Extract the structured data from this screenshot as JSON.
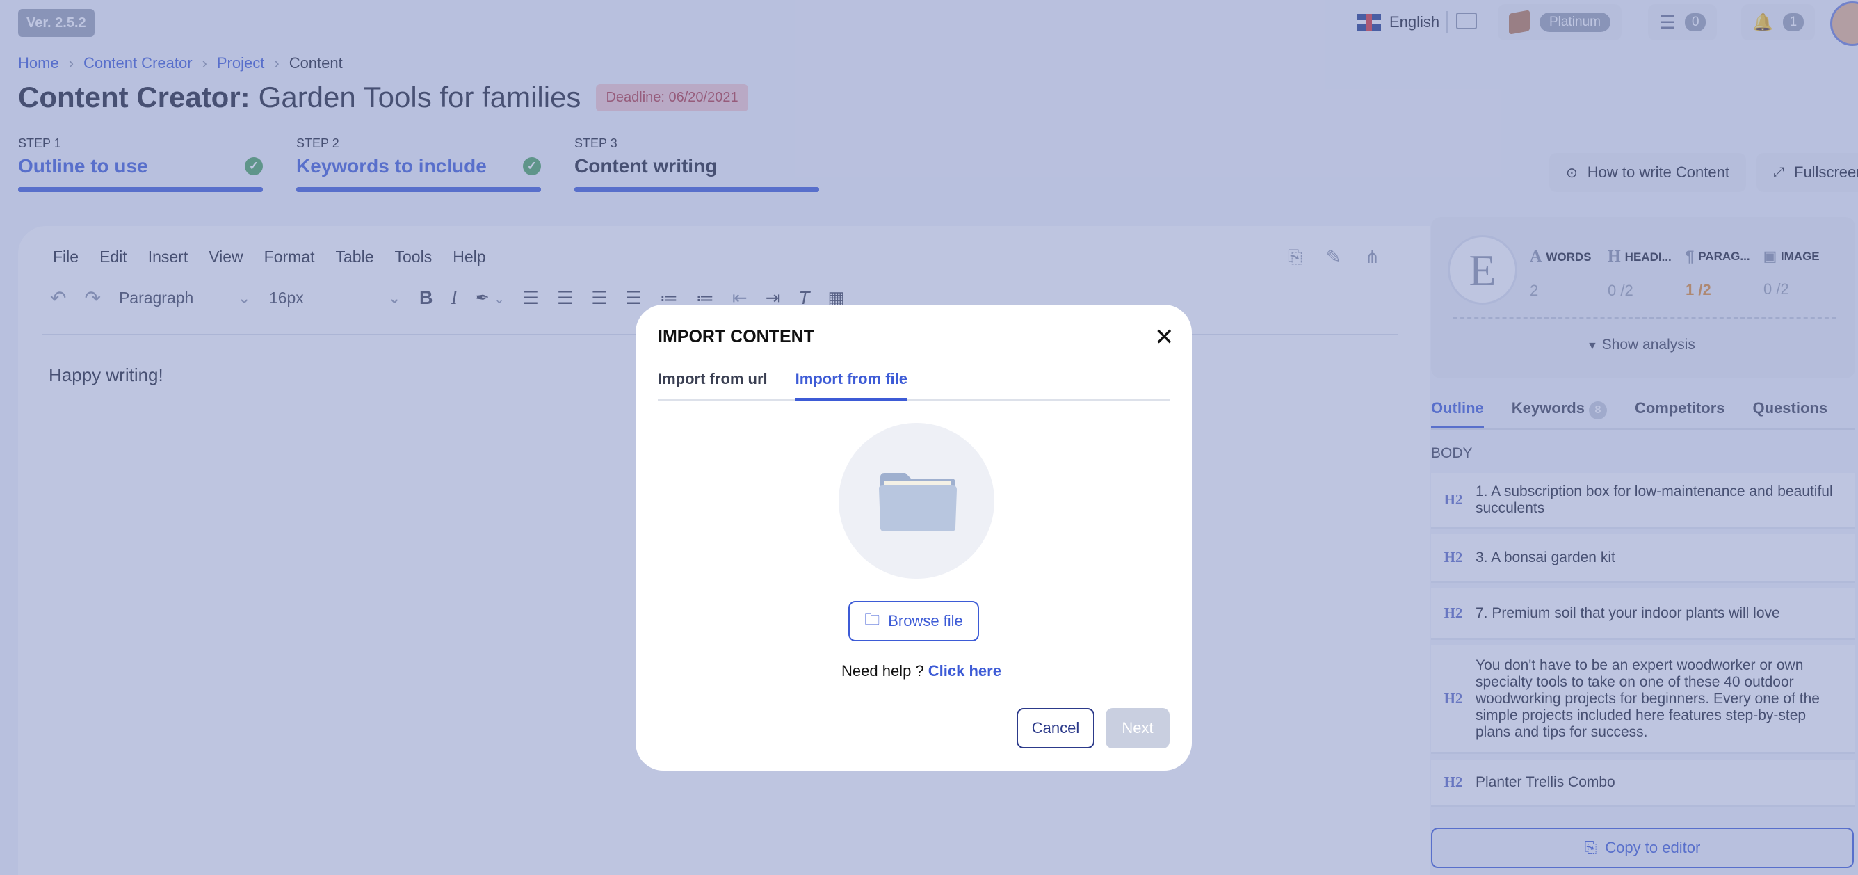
{
  "header": {
    "version": "Ver. 2.5.2",
    "language": "English",
    "plan_badge": "Platinum",
    "tasks_count": "0",
    "notifications_count": "1"
  },
  "breadcrumb": [
    "Home",
    "Content Creator",
    "Project",
    "Content"
  ],
  "page_title": {
    "prefix": "Content Creator:",
    "name": "Garden Tools for families",
    "deadline": "Deadline: 06/20/2021"
  },
  "steps": [
    {
      "label": "STEP 1",
      "name": "Outline to use",
      "done": true
    },
    {
      "label": "STEP 2",
      "name": "Keywords to include",
      "done": true
    },
    {
      "label": "STEP 3",
      "name": "Content writing",
      "done": false
    }
  ],
  "actions": {
    "how_to": "How to write Content",
    "fullscreen": "Fullscreen"
  },
  "editor": {
    "menu": [
      "File",
      "Edit",
      "Insert",
      "View",
      "Format",
      "Table",
      "Tools",
      "Help"
    ],
    "block_format": "Paragraph",
    "font_size": "16px",
    "content": "Happy writing!"
  },
  "analysis": {
    "grade": "E",
    "metrics": [
      {
        "icon": "A",
        "label": "WORDS",
        "value": "2"
      },
      {
        "icon": "H",
        "label": "HEADI...",
        "value": "0 /2"
      },
      {
        "icon": "¶",
        "label": "PARAG...",
        "value": "1 /2",
        "color": "#e08a2c"
      },
      {
        "icon": "▣",
        "label": "IMAGE",
        "value": "0 /2"
      }
    ],
    "show_analysis": "Show analysis"
  },
  "right_tabs": [
    {
      "label": "Outline",
      "active": true
    },
    {
      "label": "Keywords",
      "badge": "8"
    },
    {
      "label": "Competitors"
    },
    {
      "label": "Questions"
    }
  ],
  "outline": {
    "section_label": "BODY",
    "items": [
      {
        "tag": "H2",
        "text": "1. A subscription box for low-maintenance and beautiful succulents"
      },
      {
        "tag": "H2",
        "text": "3. A bonsai garden kit"
      },
      {
        "tag": "H2",
        "text": "7. Premium soil that your indoor plants will love"
      },
      {
        "tag": "H2",
        "text": "You don't have to be an expert woodworker or own specialty tools to take on one of these 40 outdoor woodworking projects for beginners. Every one of the simple projects included here features step-by-step plans and tips for success."
      },
      {
        "tag": "H2",
        "text": "Planter Trellis Combo"
      }
    ],
    "copy_button": "Copy to editor"
  },
  "modal": {
    "title": "IMPORT CONTENT",
    "tabs": [
      {
        "label": "Import from url",
        "active": false
      },
      {
        "label": "Import from file",
        "active": true
      }
    ],
    "browse_button": "Browse file",
    "help_text": "Need help ?",
    "help_link": "Click here",
    "cancel": "Cancel",
    "next": "Next"
  },
  "colors": {
    "accent": "#3d5bd6",
    "success": "#4aa35a",
    "deadline_bg": "#f6c9cc",
    "overlay": "rgba(120,134,190,0.48)"
  }
}
